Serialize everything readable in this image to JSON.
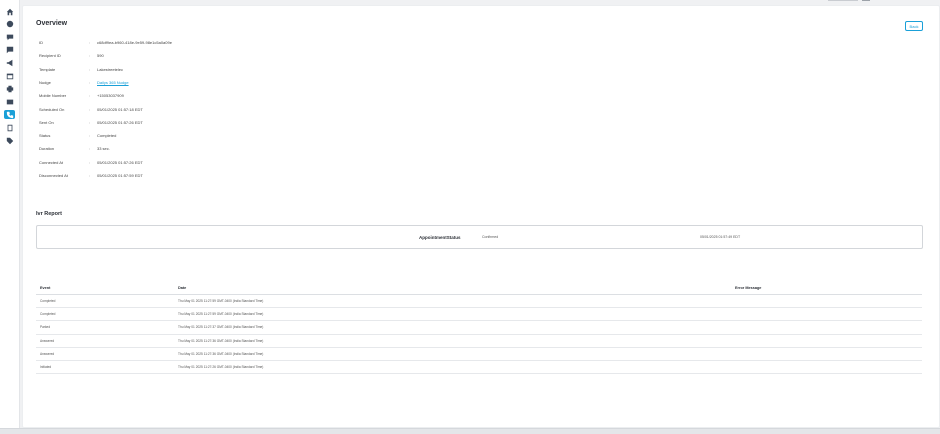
{
  "overview": {
    "title": "Overview",
    "back_label": "Back",
    "fields": [
      {
        "label": "ID",
        "value": "c68df9ea-b960-418e-9e59-98e1c5a0a09e",
        "link": false
      },
      {
        "label": "Recipient ID",
        "value": "590",
        "link": false
      },
      {
        "label": "Template",
        "value": "Lakestreetelec",
        "link": false
      },
      {
        "label": "Nudge",
        "value": "Dailys 365 Nudge",
        "link": true
      },
      {
        "label": "Mobile Number",
        "value": "+15053037909",
        "link": false
      },
      {
        "label": "Scheduled On",
        "value": "05/01/2025 01:57:18 EDT",
        "link": false
      },
      {
        "label": "Sent On",
        "value": "05/01/2025 01:57:26 EDT",
        "link": false
      },
      {
        "label": "Status",
        "value": "Completed",
        "link": false
      },
      {
        "label": "Duration",
        "value": "33 sec.",
        "link": false
      },
      {
        "label": "Connected At",
        "value": "05/01/2025 01:57:26 EDT",
        "link": false
      },
      {
        "label": "Disconnected At",
        "value": "05/01/2025 01:57:59 EDT",
        "link": false
      }
    ]
  },
  "ivr_report": {
    "title": "Ivr Report",
    "key": "AppointmentStatus",
    "value": "Confirmed",
    "timestamp": "05/01/2025 01:57:49 EDT"
  },
  "events": {
    "headers": [
      "Event",
      "Date",
      "Error Message"
    ],
    "rows": [
      [
        "Completed",
        "Thu May 01 2025 11:27:59 GMT-0400 (India Standard Time)",
        ""
      ],
      [
        "Completed",
        "Thu May 01 2025 11:27:59 GMT-0400 (India Standard Time)",
        ""
      ],
      [
        "Parked",
        "Thu May 01 2025 11:27:37 GMT-0400 (India Standard Time)",
        ""
      ],
      [
        "Answered",
        "Thu May 01 2025 11:27:36 GMT-0400 (India Standard Time)",
        ""
      ],
      [
        "Answered",
        "Thu May 01 2025 11:27:36 GMT-0400 (India Standard Time)",
        ""
      ],
      [
        "Initiated",
        "Thu May 01 2025 11:27:26 GMT-0400 (India Standard Time)",
        ""
      ]
    ]
  },
  "sidebar": {
    "icons": [
      "home-icon",
      "user-circle-icon",
      "chat-icon",
      "message-icon",
      "megaphone-icon",
      "calendar-icon",
      "print-icon",
      "mail-icon",
      "phone-icon",
      "book-icon",
      "tag-icon"
    ],
    "active_index": 8
  }
}
